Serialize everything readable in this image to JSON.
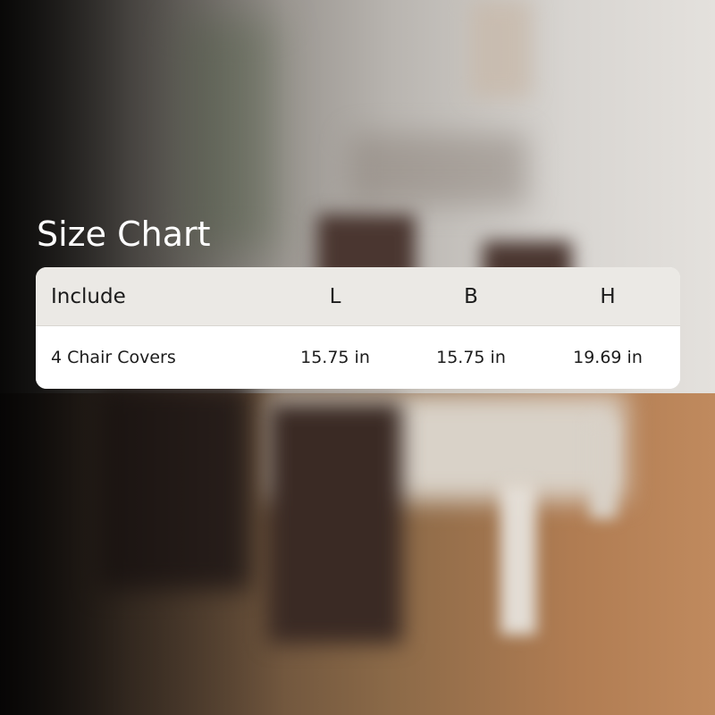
{
  "title": "Size Chart",
  "table": {
    "headers": [
      "Include",
      "L",
      "B",
      "H"
    ],
    "rows": [
      [
        "4 Chair Covers",
        "15.75 in",
        "15.75 in",
        "19.69 in"
      ]
    ]
  },
  "colors": {
    "header_bg": "#ebe9e5",
    "body_bg": "#ffffff",
    "title_text": "#ffffff",
    "table_text": "#1c1c1c"
  }
}
